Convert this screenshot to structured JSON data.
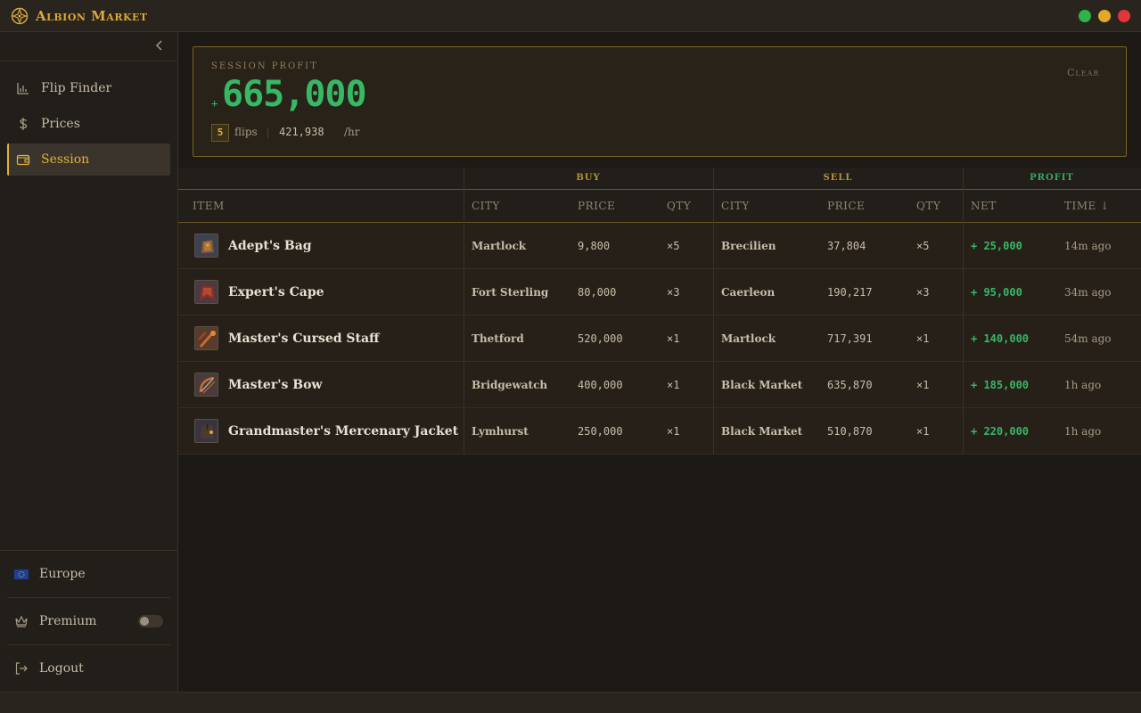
{
  "app": {
    "title": "Albion Market"
  },
  "sidebar": {
    "items": [
      {
        "label": "Flip Finder",
        "icon": "bar-chart-icon"
      },
      {
        "label": "Prices",
        "icon": "dollar-icon"
      },
      {
        "label": "Session",
        "icon": "wallet-icon",
        "active": true
      }
    ],
    "region": "Europe",
    "premium_label": "Premium",
    "premium_enabled": false,
    "logout_label": "Logout"
  },
  "session": {
    "label": "Session Profit",
    "sign": "+",
    "profit": "665,000",
    "clear_label": "Clear",
    "flips_count": "5",
    "flips_label": "flips",
    "rate": "421,938",
    "rate_unit": "/hr"
  },
  "table": {
    "groups": {
      "buy": "Buy",
      "sell": "Sell",
      "profit": "Profit"
    },
    "headers": {
      "item": "Item",
      "buy_city": "City",
      "buy_price": "Price",
      "buy_qty": "Qty",
      "sell_city": "City",
      "sell_price": "Price",
      "sell_qty": "Qty",
      "net": "Net",
      "time": "Time ↓"
    },
    "rows": [
      {
        "item": "Adept's Bag",
        "buy_city": "Martlock",
        "buy_price": "9,800",
        "buy_qty": "×5",
        "sell_city": "Brecilien",
        "sell_price": "37,804",
        "sell_qty": "×5",
        "net": "+ 25,000",
        "time": "14m ago"
      },
      {
        "item": "Expert's Cape",
        "buy_city": "Fort Sterling",
        "buy_price": "80,000",
        "buy_qty": "×3",
        "sell_city": "Caerleon",
        "sell_price": "190,217",
        "sell_qty": "×3",
        "net": "+ 95,000",
        "time": "34m ago"
      },
      {
        "item": "Master's Cursed Staff",
        "buy_city": "Thetford",
        "buy_price": "520,000",
        "buy_qty": "×1",
        "sell_city": "Martlock",
        "sell_price": "717,391",
        "sell_qty": "×1",
        "net": "+ 140,000",
        "time": "54m ago"
      },
      {
        "item": "Master's Bow",
        "buy_city": "Bridgewatch",
        "buy_price": "400,000",
        "buy_qty": "×1",
        "sell_city": "Black Market",
        "sell_price": "635,870",
        "sell_qty": "×1",
        "net": "+ 185,000",
        "time": "1h ago"
      },
      {
        "item": "Grandmaster's Mercenary Jacket",
        "buy_city": "Lymhurst",
        "buy_price": "250,000",
        "buy_qty": "×1",
        "sell_city": "Black Market",
        "sell_price": "510,870",
        "sell_qty": "×1",
        "net": "+ 220,000",
        "time": "1h ago"
      }
    ]
  },
  "colors": {
    "accent": "#e0b23a",
    "profit": "#36b865",
    "background": "#1d1915"
  }
}
